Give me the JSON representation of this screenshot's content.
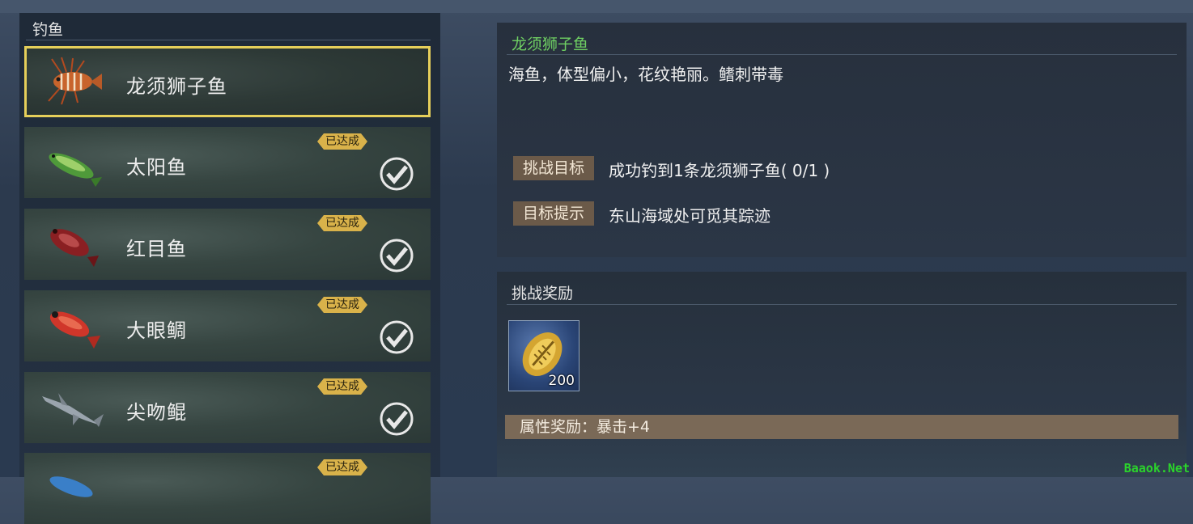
{
  "fishing": {
    "header": "钓鱼",
    "items": [
      {
        "name": "龙须狮子鱼",
        "fish_icon": "lionfish-icon",
        "selected": true,
        "badge": "",
        "completed": false
      },
      {
        "name": "太阳鱼",
        "fish_icon": "green-fish-icon",
        "selected": false,
        "badge": "已达成",
        "completed": true
      },
      {
        "name": "红目鱼",
        "fish_icon": "red-fish-icon",
        "selected": false,
        "badge": "已达成",
        "completed": true
      },
      {
        "name": "大眼鲷",
        "fish_icon": "red-bigeye-fish-icon",
        "selected": false,
        "badge": "已达成",
        "completed": true
      },
      {
        "name": "尖吻鲲",
        "fish_icon": "shark-icon",
        "selected": false,
        "badge": "已达成",
        "completed": true
      },
      {
        "name": "",
        "fish_icon": "blue-fish-icon",
        "selected": false,
        "badge": "已达成",
        "completed": true
      }
    ]
  },
  "detail": {
    "title": "龙须狮子鱼",
    "description": "海鱼，体型偏小，花纹艳丽。鳍刺带毒",
    "challenge_goal_label": "挑战目标",
    "challenge_goal_text": "成功钓到1条龙须狮子鱼( 0/1 )",
    "hint_label": "目标提示",
    "hint_text": "东山海域处可觅其踪迹"
  },
  "reward": {
    "title": "挑战奖励",
    "item_icon": "gold-shell-icon",
    "item_count": "200",
    "attribute_text": "属性奖励：暴击+4"
  },
  "watermark": "Baaok.Net",
  "colors": {
    "selected_border": "#e6cf5a",
    "badge": "#d9b24a",
    "title_green": "#6fcf63",
    "tag_bg": "#6b5a49",
    "attr_bar": "#7a6957"
  }
}
